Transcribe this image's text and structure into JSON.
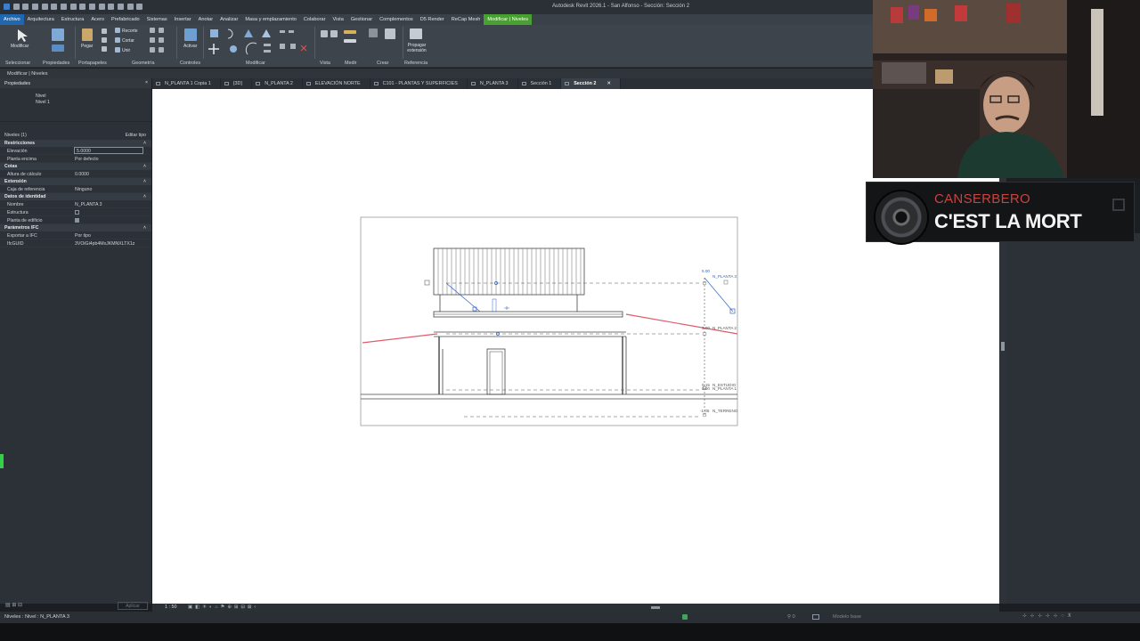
{
  "window": {
    "title": "Autodesk Revit 2026.1 - San Alfonso - Sección: Sección 2"
  },
  "ribbon_tabs": [
    "Archivo",
    "Arquitectura",
    "Estructura",
    "Acero",
    "Prefabricado",
    "Sistemas",
    "Insertar",
    "Anotar",
    "Analizar",
    "Masa y emplazamiento",
    "Colaborar",
    "Vista",
    "Gestionar",
    "Complementos",
    "D5 Render",
    "ReCap Mesh",
    "Modificar | Niveles"
  ],
  "ribbon": {
    "modify_label": "Modificar",
    "properties_label": "Propiedades",
    "paste_label": "Pegar",
    "recorte_label": "Recorte",
    "cortar_label": "Cortar",
    "unir_label": "Unir",
    "activar_label": "Activar",
    "propagar_label": "Propagar extensión",
    "groups": [
      "Seleccionar",
      "Propiedades",
      "Portapapeles",
      "Geometría",
      "Controles",
      "Modificar",
      "Vista",
      "Medir",
      "Crear",
      "Referencia"
    ]
  },
  "context_bar": "Modificar | Niveles",
  "properties": {
    "title": "Propiedades",
    "type_family": "Nivel",
    "type_name": "Nivel 1",
    "filter": "Niveles (1)",
    "edit_type": "Editar tipo",
    "apply": "Aplicar",
    "sections": {
      "restricciones": "Restricciones",
      "cotas": "Cotas",
      "extension": "Extensión",
      "identidad": "Datos de identidad",
      "ifc": "Parámetros IFC"
    },
    "rows": {
      "elevacion_label": "Elevación",
      "elevacion_value": "5.0000",
      "planta_encima_label": "Planta encima",
      "planta_encima_value": "Por defecto",
      "altura_calculo_label": "Altura de cálculo",
      "altura_calculo_value": "0.0000",
      "caja_ref_label": "Caja de referencia",
      "caja_ref_value": "Ninguno",
      "nombre_label": "Nombre",
      "nombre_value": "N_PLANTA 3",
      "estructura_label": "Estructura",
      "planta_edificio_label": "Planta de edificio",
      "exportar_ifc_label": "Exportar a IFC",
      "exportar_ifc_value": "Por tipo",
      "ifcguid_label": "IfcGUID",
      "ifcguid_value": "3VOiGi4pb4MxJKMNXLTX1z"
    }
  },
  "view_tabs": [
    "N_PLANTA 1 Copia 1",
    "{3D}",
    "N_PLANTA 2",
    "ELEVACIÓN NORTE",
    "C101 - PLANTAS Y SUPERFICIES",
    "N_PLANTA 3",
    "Sección 1",
    "Sección 2"
  ],
  "drawing": {
    "level_tags": {
      "planta3": "N_PLANTA 3",
      "planta3_elev": "5.00",
      "planta2": "N_PLANTA 2",
      "planta2_elev": "3.00",
      "estudio": "N_ESTUDIO",
      "estudio_elev": "0.15",
      "planta1": "N_PLANTA 1",
      "planta1_elev": "0.00",
      "terreno": "N_TERRENO",
      "terreno_elev": "-1.05"
    }
  },
  "view_bar": {
    "scale": "1 : 50"
  },
  "status": {
    "message": "Niveles : Nivel : N_PLANTA 3",
    "model": "Modelo base"
  },
  "now_playing": {
    "artist": "CANSERBERO",
    "song": "C'EST LA MORT"
  },
  "colors": {
    "ribbon_bg": "#3e444b",
    "accent_blue": "#1f67b1",
    "context_green": "#47a12e",
    "artist_red": "#c9433e",
    "level_blue": "#3466c2",
    "section_red": "#e05a6a"
  }
}
